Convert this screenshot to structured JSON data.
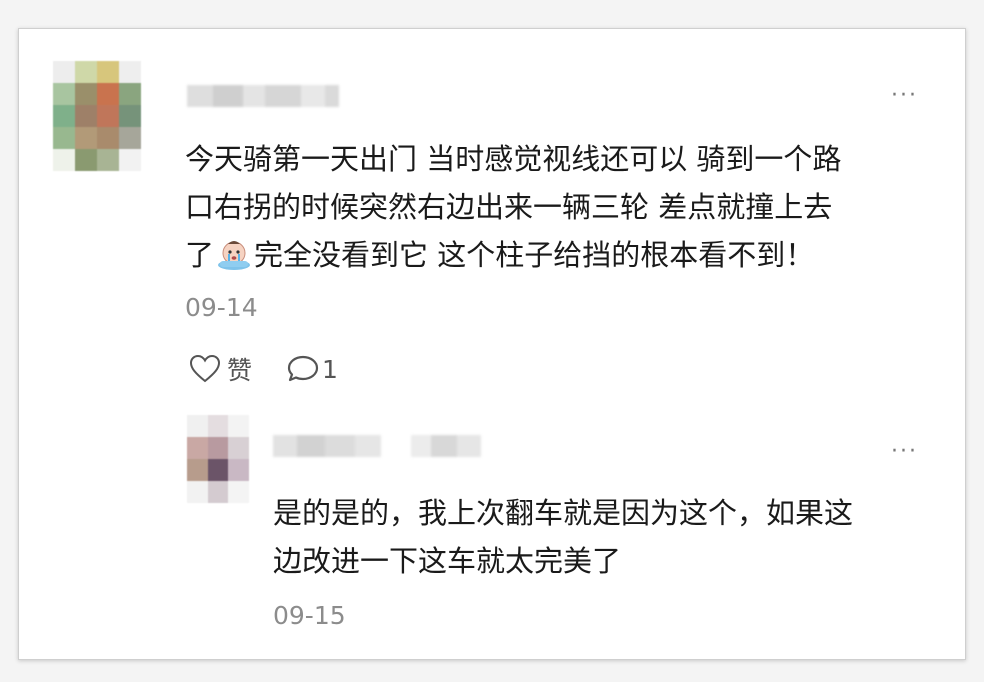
{
  "post": {
    "line1": "今天骑第一天出门 当时感觉视线还可以 骑到一个路",
    "line2": "口右拐的时候突然右边出来一辆三轮 差点就撞上去",
    "line3_before": "了",
    "line3_after": "完全没看到它 这个柱子给挡的根本看不到！",
    "emoji_icon": "crying-face-icon",
    "date": "09-14",
    "more_label": "···",
    "like_label": "赞",
    "comment_count": "1"
  },
  "reply": {
    "line1": "是的是的，我上次翻车就是因为这个，如果这",
    "line2": "边改进一下这车就太完美了",
    "date": "09-15",
    "more_label": "···"
  },
  "colors": {
    "text": "#1a1a1a",
    "meta": "#8c8c8c",
    "icon": "#555555"
  }
}
